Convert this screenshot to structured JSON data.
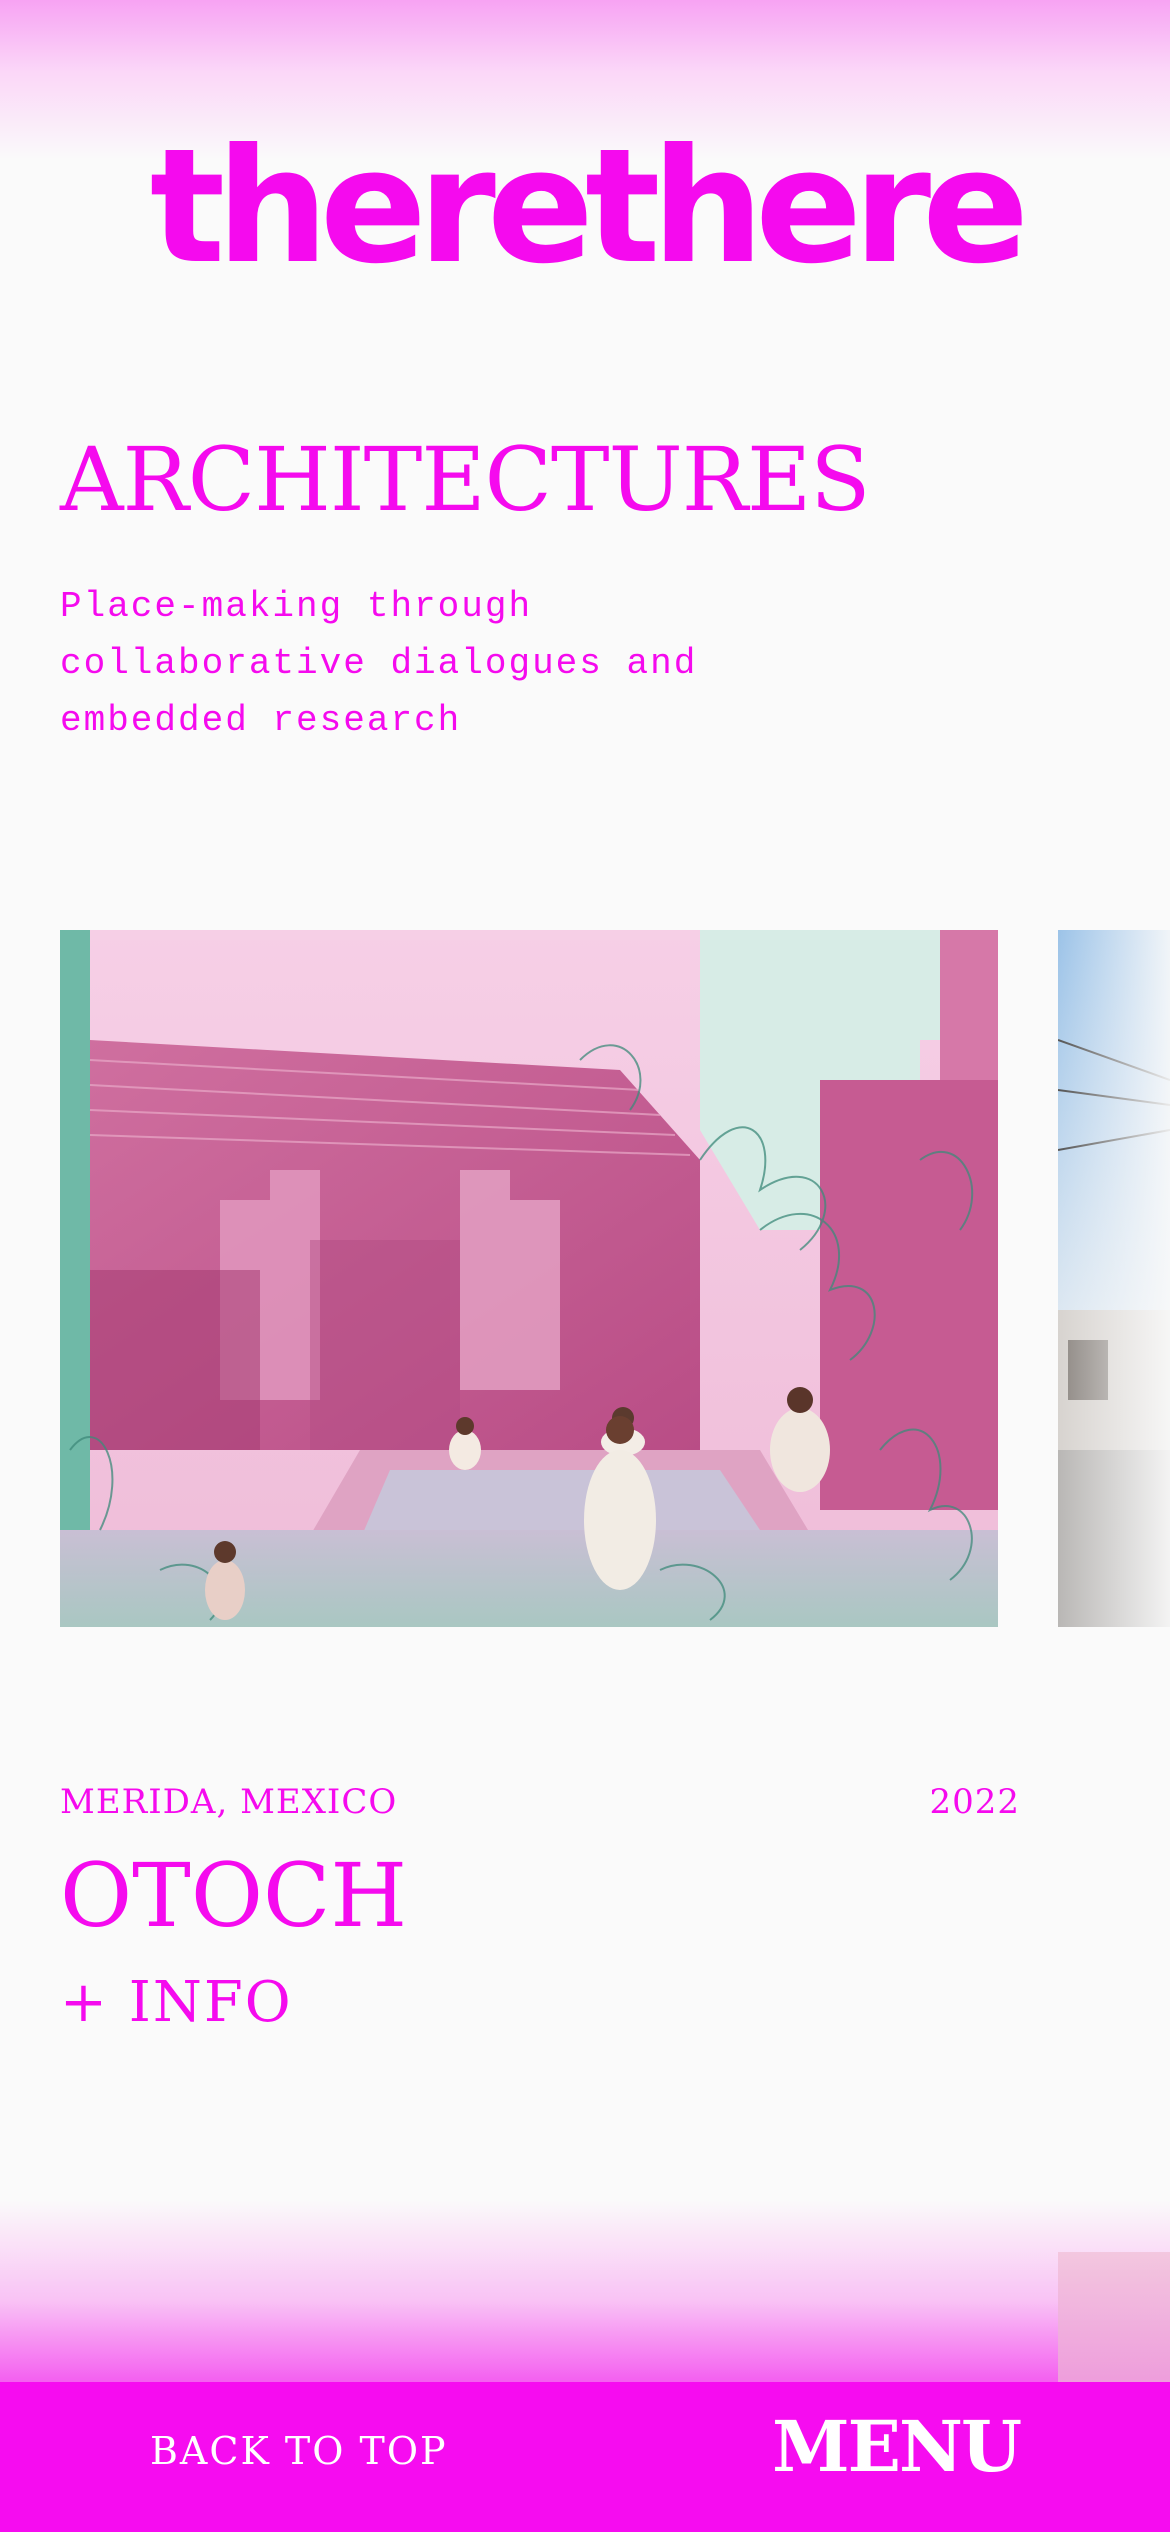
{
  "brand": {
    "logo_text": "therethere",
    "accent_color": "#f50aee"
  },
  "section": {
    "title": "ARCHITECTURES",
    "description": "Place-making through collaborative dialogues and embedded research"
  },
  "project": {
    "location": "MERIDA, MEXICO",
    "year": "2022",
    "title": "OTOCH",
    "info_link": "+ INFO"
  },
  "footer": {
    "back_to_top": "BACK TO TOP",
    "menu": "MENU"
  }
}
